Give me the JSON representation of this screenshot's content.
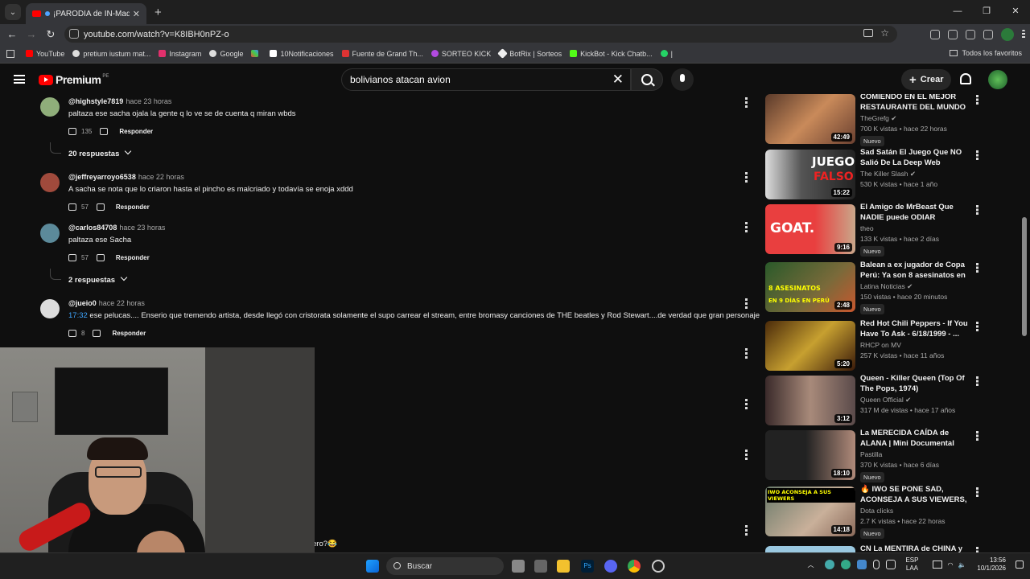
{
  "browser": {
    "tab_title": "¡PARODIA de IN-Maduro!",
    "url": "youtube.com/watch?v=K8IBH0nPZ-o",
    "bookmarks": [
      "YouTube",
      "pretium iustum mat...",
      "Instagram",
      "Google",
      "",
      "10Notificaciones",
      "Fuente de Grand Th...",
      "SORTEO KICK",
      "BotRix | Sorteos",
      "KickBot - Kick Chatb...",
      "|"
    ],
    "all_bookmarks": "Todos los favoritos"
  },
  "youtube": {
    "logo": "Premium",
    "region": "PE",
    "search_query": "bolivianos atacan avion",
    "create_label": "Crear"
  },
  "comments": [
    {
      "handle": "@highstyle7819",
      "time": "hace 23 horas",
      "text": "paltaza ese sacha ojala la gente q lo ve se de cuenta q miran wbds",
      "likes": "135",
      "reply": "Responder",
      "replies": "20 respuestas"
    },
    {
      "handle": "@jeffreyarroyo6538",
      "time": "hace 22 horas",
      "text": "A sacha se nota que lo criaron hasta el pincho es malcriado y todavía se enoja xddd",
      "likes": "57",
      "reply": "Responder"
    },
    {
      "handle": "@carlos84708",
      "time": "hace 23 horas",
      "text": "paltaza ese Sacha",
      "likes": "57",
      "reply": "Responder",
      "replies": "2 respuestas"
    },
    {
      "handle": "@jueio0",
      "time": "hace 22 horas",
      "timestamp": "17:32",
      "text": " ese pelucas.... Enserio que tremendo artista, desde llegó con cristorata solamente el supo carrear el stream, entre bromasy canciones de THE beatles y Rod Stewart....de verdad que gran personaje",
      "likes": "8",
      "reply": "Responder"
    }
  ],
  "partial_comment": "ero?😂",
  "related": [
    {
      "title": "COMIENDO EN EL MEJOR RESTAURANTE DEL MUNDO",
      "channel": "TheGrefg",
      "meta": "700 K vistas • hace 22 horas",
      "duration": "42:49",
      "badge": "Nuevo",
      "verified": true
    },
    {
      "title": "Sad Satán El Juego Que NO Salió De La Deep Web",
      "channel": "The Killer Slash",
      "meta": "530 K vistas • hace 1 año",
      "duration": "15:22",
      "verified": true
    },
    {
      "title": "El Amigo de MrBeast Que NADIE puede ODIAR",
      "channel": "theo",
      "meta": "133 K vistas • hace 2 días",
      "duration": "9:16",
      "badge": "Nuevo"
    },
    {
      "title": "Balean a ex jugador de Copa Perú: Ya son 8 asesinatos en l...",
      "channel": "Latina Noticias",
      "meta": "150 vistas • hace 20 minutos",
      "duration": "2:48",
      "badge": "Nuevo",
      "verified": true
    },
    {
      "title": "Red Hot Chili Peppers - If You Have To Ask - 6/18/1999 - ...",
      "channel": "RHCP on MV",
      "meta": "257 K vistas • hace 11 años",
      "duration": "5:20"
    },
    {
      "title": "Queen - Killer Queen (Top Of The Pops, 1974)",
      "channel": "Queen Official",
      "meta": "317 M de vistas • hace 17 años",
      "duration": "3:12",
      "verified": true
    },
    {
      "title": "La MERECIDA CAÍDA de ALANA | Mini Documental",
      "channel": "Pastilla",
      "meta": "370 K vistas • hace 6 días",
      "duration": "18:10",
      "badge": "Nuevo"
    },
    {
      "title": "🔥 IWO SE PONE SAD, ACONSEJA A SUS VIEWERS, Y...",
      "channel": "Dota clicks",
      "meta": "2.7 K vistas • hace 22 horas",
      "duration": "14:18",
      "badge": "Nuevo"
    },
    {
      "title": "CN La MENTIRA de CHINA y su..."
    }
  ],
  "thumb_text": {
    "juego": "JUEGO",
    "falso": "FALSO",
    "goat": "GOAT.",
    "ases": "8 ASESINATOS",
    "peru": "EN 9 DÍAS EN PERÚ",
    "iwo": "IWO ACONSEJA A SUS VIEWERS"
  },
  "taskbar": {
    "search": "Buscar",
    "lang1": "ESP",
    "lang2": "LAA",
    "time": "13:56",
    "date": "10/1/2026"
  }
}
